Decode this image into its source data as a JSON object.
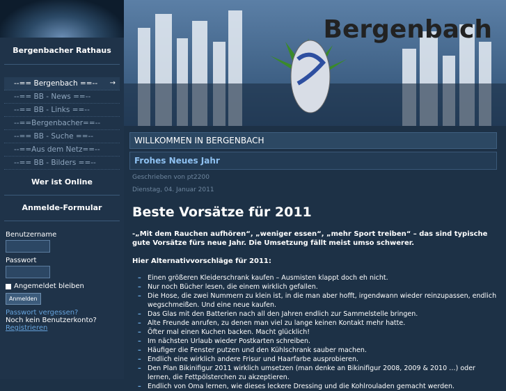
{
  "sidebar": {
    "title": "Bergenbacher Rathaus",
    "menu": [
      {
        "label": "--== Bergenbach ==--",
        "active": true
      },
      {
        "label": "--== BB - News ==--"
      },
      {
        "label": "--== BB - Links ==--"
      },
      {
        "label": "--==Bergenbacher==--"
      },
      {
        "label": "--== BB - Suche ==--"
      },
      {
        "label": "--==Aus dem Netz==--"
      },
      {
        "label": "--== BB - Bilders ==--"
      }
    ],
    "arrow": "→",
    "who_online": "Wer ist Online",
    "login_title": "Anmelde-Formular",
    "username_label": "Benutzername",
    "password_label": "Passwort",
    "remember_label": "Angemeldet bleiben",
    "login_button": "Anmelden",
    "forgot_password": "Passwort vergessen?",
    "no_account": "Noch kein Benutzerkonto?",
    "register": "Registrieren"
  },
  "banner": {
    "title": "Bergenbach"
  },
  "article": {
    "section_title": "WILLKOMMEN IN BERGENBACH",
    "title": "Frohes Neues Jahr",
    "author": "Geschrieben von pt2200",
    "date": "Dienstag, 04. Januar 2011",
    "headline": "Beste Vorsätze für 2011",
    "intro": "-„Mit dem Rauchen aufhören“, „weniger essen“, „mehr Sport treiben“ – das sind typische gute Vorsätze fürs neue Jahr. Die Umsetzung fällt meist umso schwerer.",
    "subhead": "Hier Alternativvorschläge für 2011:",
    "items": [
      "Einen größeren Kleiderschrank kaufen –  Ausmisten klappt doch eh nicht.",
      "Nur noch Bücher lesen, die einem wirklich gefallen.",
      "Die Hose, die zwei Nummern zu klein ist, in die man aber hofft, irgendwann wieder reinzupassen, endlich wegschmeißen. Und eine neue kaufen.",
      "Das Glas mit den Batterien nach all den Jahren endlich zur Sammelstelle bringen.",
      "Alte Freunde anrufen, zu denen man viel zu lange keinen Kontakt mehr hatte.",
      "Öfter mal einen Kuchen backen. Macht glücklich!",
      "Im nächsten Urlaub wieder Postkarten schreiben.",
      "Häufiger die Fenster putzen und den Kühlschrank sauber machen.",
      "Endlich eine wirklich andere Frisur und Haarfarbe ausprobieren.",
      "Den Plan Bikinifigur 2011 wirklich umsetzen (man denke an Bikinifigur 2008, 2009 & 2010 …) oder lernen, die Fettpölsterchen zu akzeptieren.",
      "Endlich von Oma lernen, wie dieses leckere Dressing und die Kohlrouladen gemacht werden."
    ]
  }
}
